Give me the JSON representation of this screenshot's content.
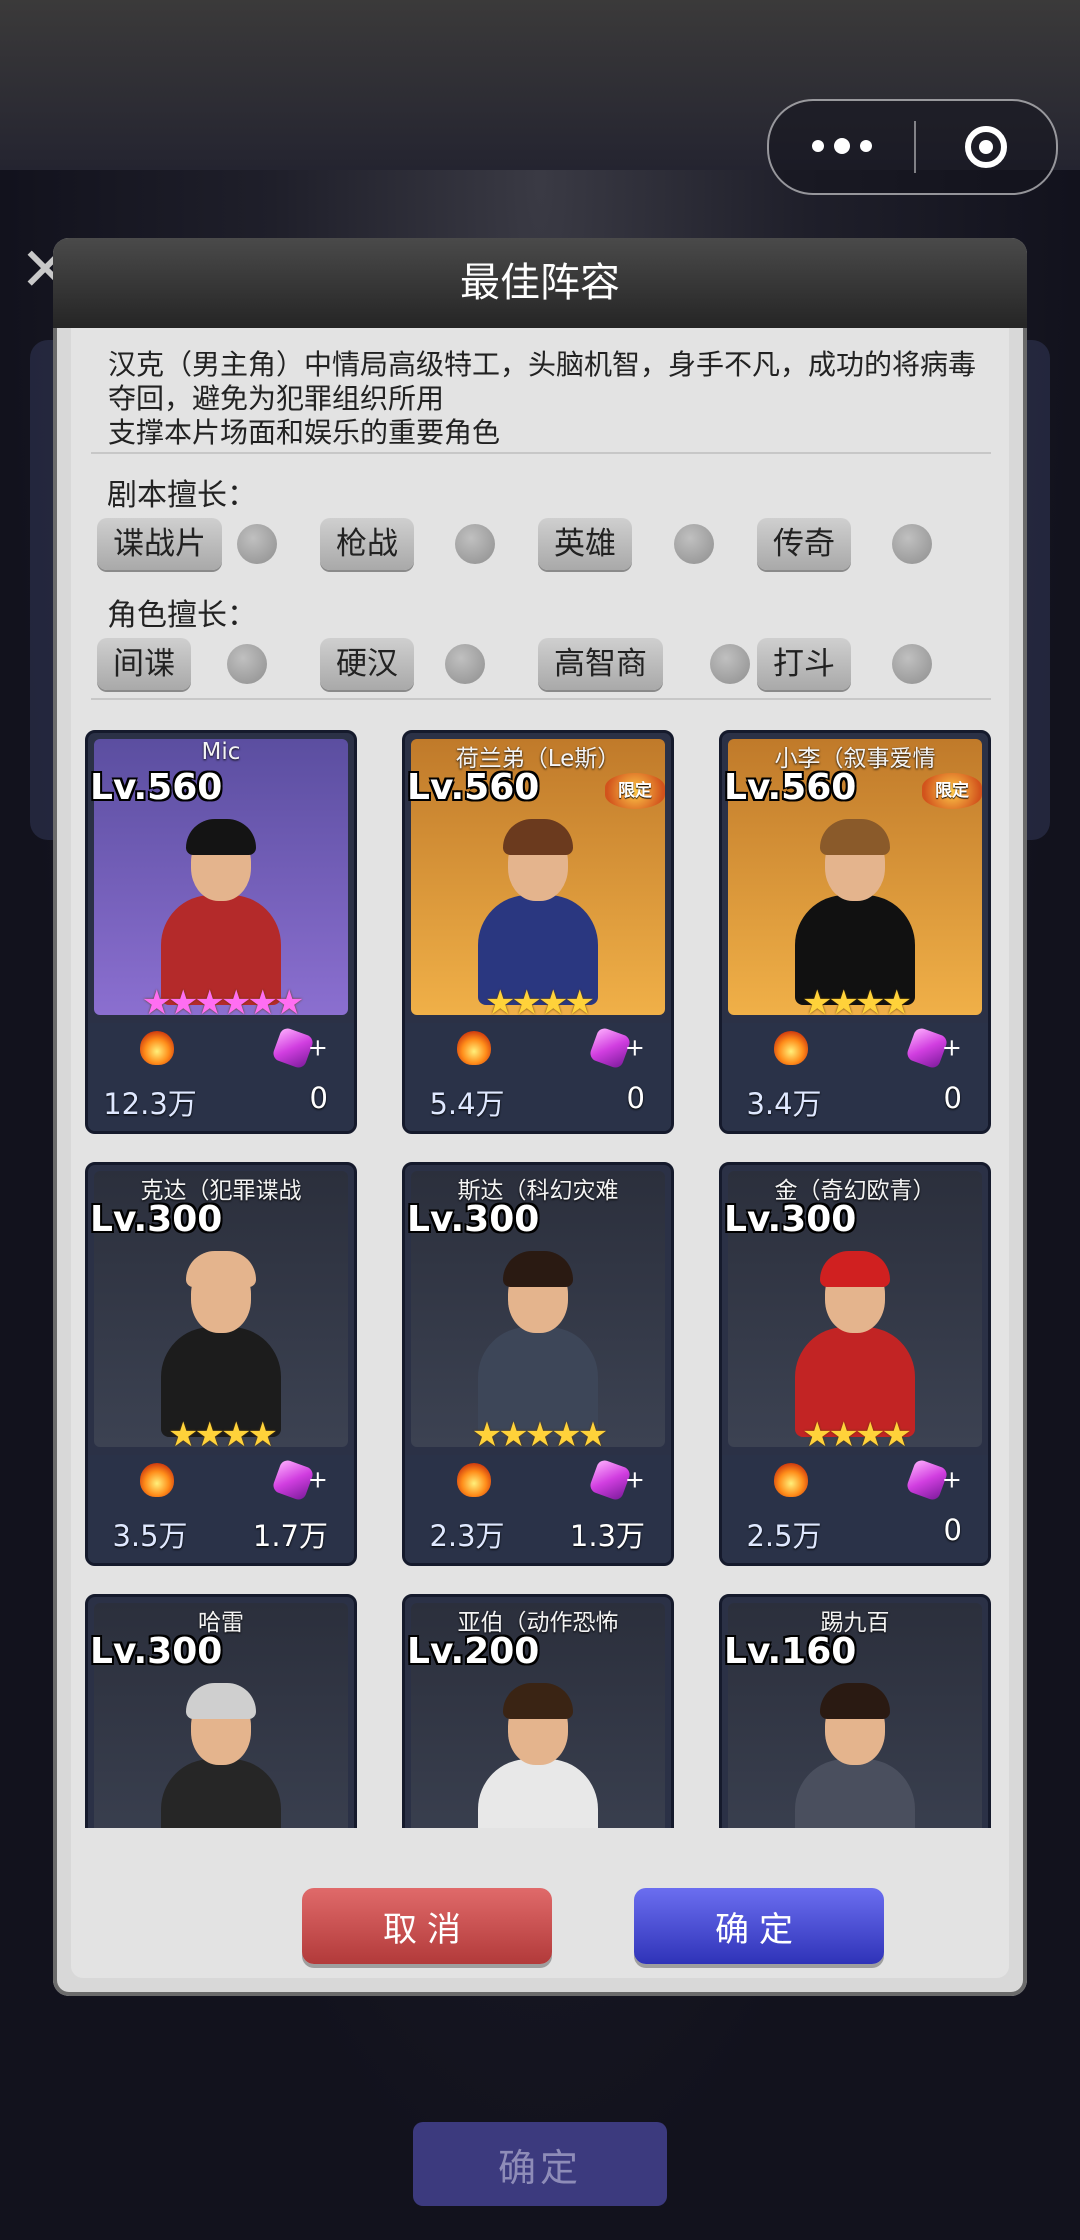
{
  "background": {
    "confirm_label": "确定"
  },
  "capsule": {
    "more_icon": "more-dots-icon",
    "close_icon": "target-close-icon"
  },
  "dialog": {
    "title": "最佳阵容",
    "description": [
      "汉克（男主角）中情局高级特工，头脑机智，身手不凡，成功的将病毒夺回，避免为犯罪组织所用",
      "支撑本片场面和娱乐的重要角色"
    ],
    "script_strength": {
      "label": "剧本擅长：",
      "tags": [
        "谍战片",
        "枪战",
        "英雄",
        "传奇"
      ]
    },
    "role_strength": {
      "label": "角色擅长：",
      "tags": [
        "间谍",
        "硬汉",
        "高智商",
        "打斗"
      ]
    },
    "heroes": [
      {
        "name": "Mic",
        "level": "Lv.560",
        "stars": 6,
        "star_color": "pink",
        "limited": false,
        "power": "12.3万",
        "gem": "0"
      },
      {
        "name": "荷兰弟（Le斯）",
        "level": "Lv.560",
        "stars": 4,
        "star_color": "gold",
        "limited": true,
        "limited_label": "限定",
        "power": "5.4万",
        "gem": "0"
      },
      {
        "name": "小李（叙事爱情",
        "level": "Lv.560",
        "stars": 4,
        "star_color": "gold",
        "limited": true,
        "limited_label": "限定",
        "power": "3.4万",
        "gem": "0"
      },
      {
        "name": "克达（犯罪谍战",
        "level": "Lv.300",
        "stars": 4,
        "star_color": "gold",
        "limited": false,
        "power": "3.5万",
        "gem": "1.7万"
      },
      {
        "name": "斯达（科幻灾难",
        "level": "Lv.300",
        "stars": 5,
        "star_color": "gold",
        "limited": false,
        "power": "2.3万",
        "gem": "1.3万"
      },
      {
        "name": "金（奇幻欧青）",
        "level": "Lv.300",
        "stars": 4,
        "star_color": "gold",
        "limited": false,
        "power": "2.5万",
        "gem": "0"
      },
      {
        "name": "哈雷",
        "level": "Lv.300",
        "stars": 0,
        "star_color": "gold",
        "limited": false,
        "power": "",
        "gem": ""
      },
      {
        "name": "亚伯（动作恐怖",
        "level": "Lv.200",
        "stars": 0,
        "star_color": "gold",
        "limited": false,
        "power": "",
        "gem": ""
      },
      {
        "name": "踢九百",
        "level": "Lv.160",
        "stars": 0,
        "star_color": "gold",
        "limited": false,
        "power": "",
        "gem": ""
      }
    ],
    "buttons": {
      "cancel": "取消",
      "ok": "确定"
    }
  }
}
